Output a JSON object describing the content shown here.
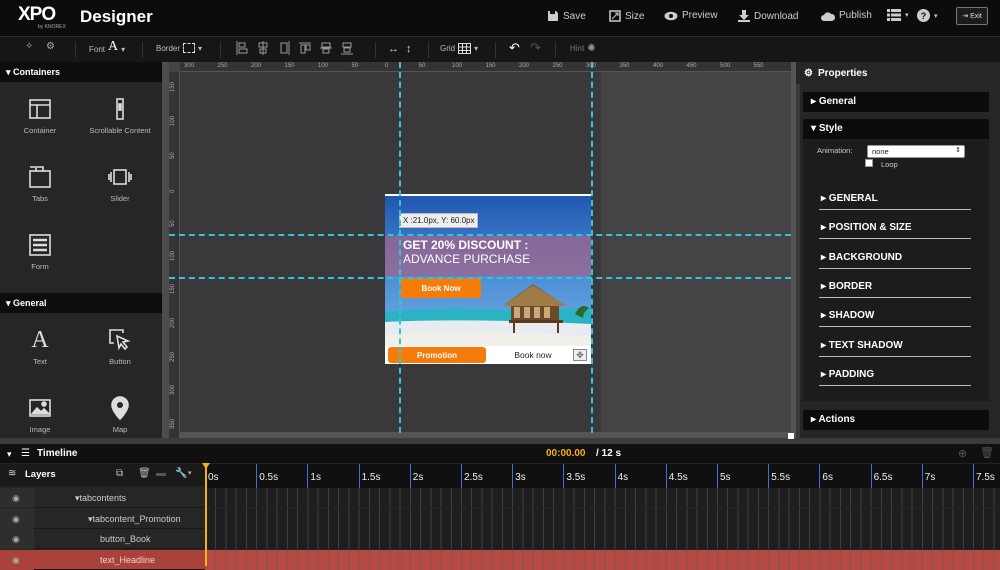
{
  "app": {
    "logo": "XPO",
    "logo_sub": "by KNOREX",
    "title": "Designer"
  },
  "topbar": {
    "save": "Save",
    "size": "Size",
    "preview": "Preview",
    "download": "Download",
    "publish": "Publish",
    "exit": "Exit"
  },
  "toolbar": {
    "font": "Font",
    "font_glyph": "A",
    "border": "Border",
    "grid": "Grid",
    "hint": "Hint"
  },
  "left_panel": {
    "containers_title": "Containers",
    "containers": [
      "Container",
      "Scrollable Content",
      "Tabs",
      "Slider",
      "Form"
    ],
    "general_title": "General",
    "general": [
      "Text",
      "Button",
      "Image",
      "Map"
    ]
  },
  "rulers": {
    "top": [
      "300",
      "250",
      "200",
      "150",
      "100",
      "50",
      "0",
      "50",
      "100",
      "150",
      "200",
      "250",
      "300",
      "350",
      "400",
      "450",
      "500",
      "550"
    ],
    "left": [
      "150",
      "100",
      "50",
      "0",
      "50",
      "100",
      "150",
      "200",
      "250",
      "300",
      "350"
    ]
  },
  "stage": {
    "coord_tooltip": "X :21.0px, Y: 60.0px",
    "headline_line1": "GET 20% DISCOUNT :",
    "headline_line2": "ADVANCE PURCHASE",
    "book_button": "Book Now",
    "tab_promotion": "Promotion",
    "tab_book": "Book now"
  },
  "properties": {
    "title": "Properties",
    "general": "General",
    "style": "Style",
    "animation_label": "Animation:",
    "animation_value": "none",
    "loop": "Loop",
    "sections": [
      "GENERAL",
      "POSITION & SIZE",
      "BACKGROUND",
      "BORDER",
      "SHADOW",
      "TEXT SHADOW",
      "PADDING"
    ],
    "actions": "Actions"
  },
  "timeline": {
    "title": "Timeline",
    "time_current": "00:00.00",
    "time_total": "/ 12 s",
    "layers_label": "Layers",
    "ticks": [
      "0s",
      "0.5s",
      "1s",
      "1.5s",
      "2s",
      "2.5s",
      "3s",
      "3.5s",
      "4s",
      "4.5s",
      "5s",
      "5.5s",
      "6s",
      "6.5s",
      "7s",
      "7.5s"
    ],
    "layers": [
      "tabcontents",
      "tabcontent_Promotion",
      "button_Book",
      "text_Headline"
    ]
  },
  "colors": {
    "accent_orange": "#f57c0a",
    "guide": "#2fc6d6",
    "selected_layer": "#a8423b",
    "headline_band": "#8d6a8f"
  }
}
